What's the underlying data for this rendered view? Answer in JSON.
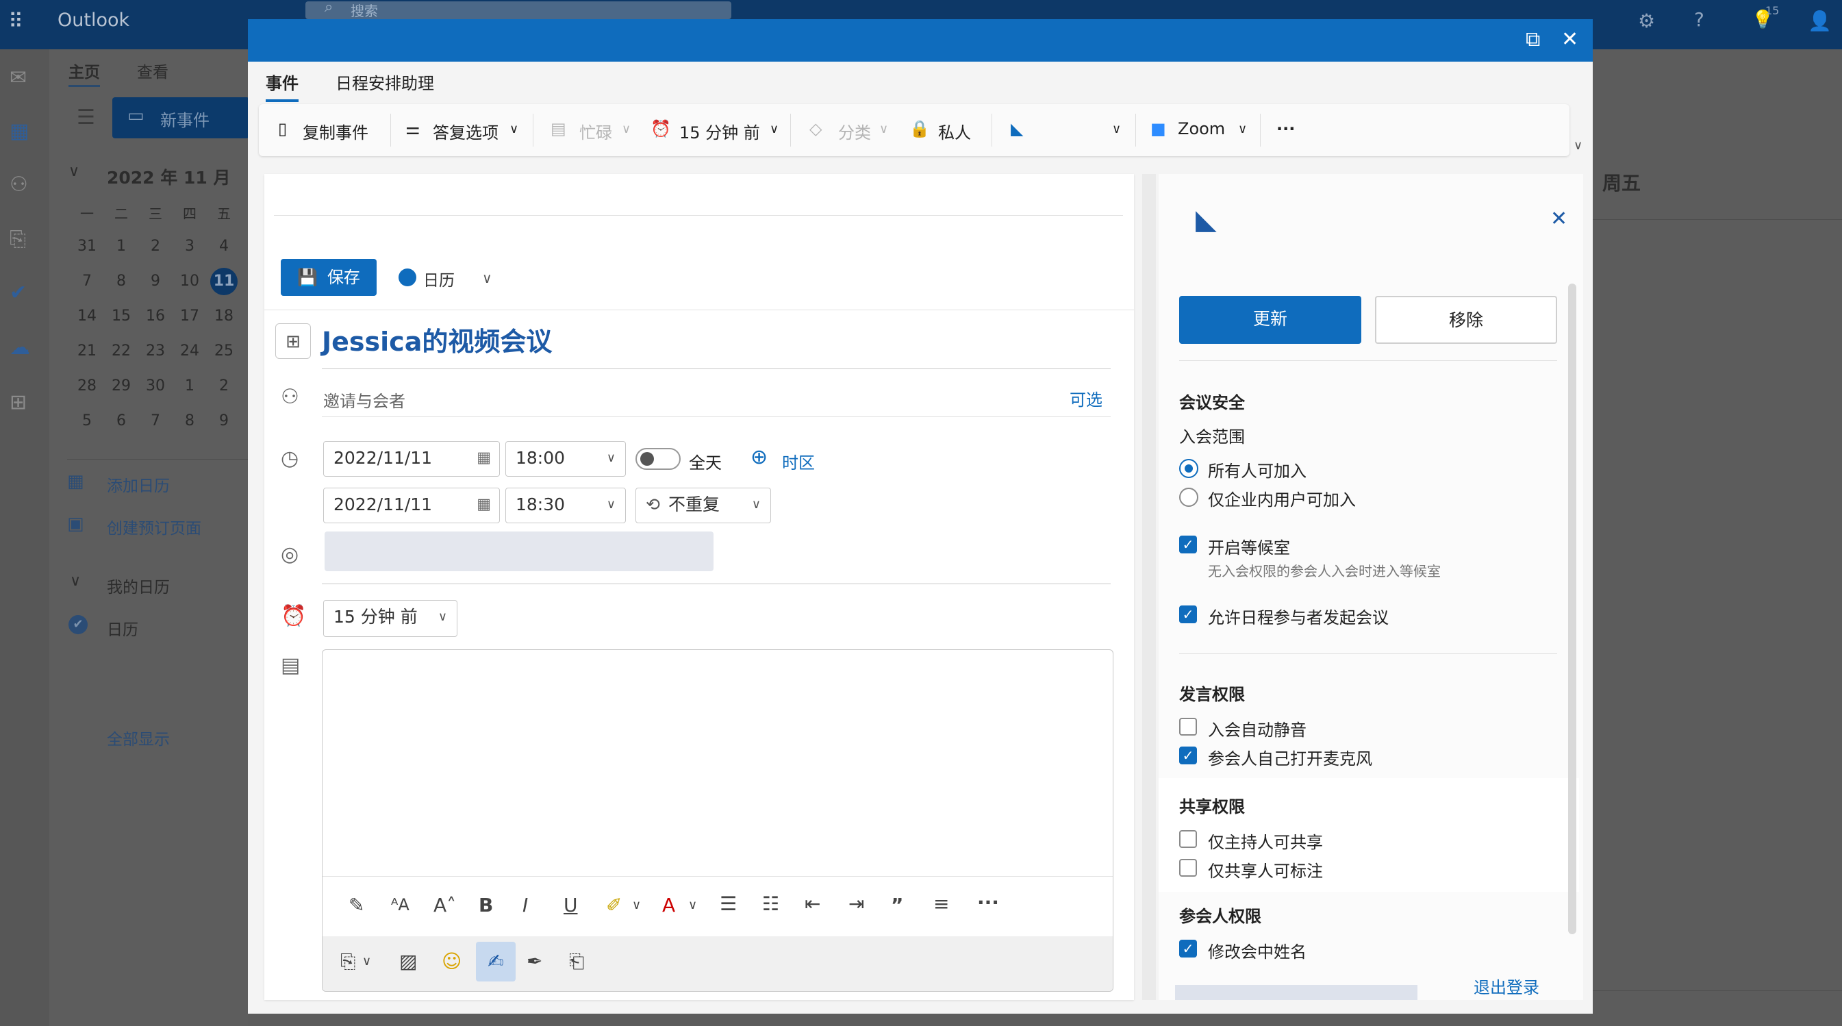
{
  "background": {
    "app_name": "Outlook",
    "search_placeholder": "搜索",
    "tabs": [
      "主页",
      "查看"
    ],
    "new_event_label": "新事件",
    "mini_calendar": {
      "title": "2022 年 11 月",
      "weekdays": [
        "一",
        "二",
        "三",
        "四",
        "五"
      ],
      "weeks": [
        [
          "31",
          "1",
          "2",
          "3",
          "4"
        ],
        [
          "7",
          "8",
          "9",
          "10",
          "11"
        ],
        [
          "14",
          "15",
          "16",
          "17",
          "18"
        ],
        [
          "21",
          "22",
          "23",
          "24",
          "25"
        ],
        [
          "28",
          "29",
          "30",
          "1",
          "2"
        ],
        [
          "5",
          "6",
          "7",
          "8",
          "9"
        ]
      ],
      "today": "11"
    },
    "add_calendar": "添加日历",
    "create_booking_page": "创建预订页面",
    "my_calendars": "我的日历",
    "calendar_item": "日历",
    "show_all": "全部显示",
    "day_header": "周五",
    "notification_badge": "15"
  },
  "modal": {
    "tabs": {
      "event": "事件",
      "scheduling": "日程安排助理"
    },
    "toolbar": {
      "copy_event": "复制事件",
      "response_options": "答复选项",
      "busy": "忙碌",
      "reminder": "15 分钟 前",
      "categorize": "分类",
      "private": "私人",
      "zoom": "Zoom",
      "more": "···"
    },
    "form": {
      "save": "保存",
      "calendar": "日历",
      "title": "Jessica的视频会议",
      "invite_placeholder": "邀请与会者",
      "optional": "可选",
      "start_date": "2022/11/11",
      "start_time": "18:00",
      "all_day": "全天",
      "timezone": "时区",
      "end_date": "2022/11/11",
      "end_time": "18:30",
      "repeat": "不重复",
      "reminder": "15 分钟 前"
    }
  },
  "addin": {
    "update_button": "更新",
    "remove_button": "移除",
    "security_heading": "会议安全",
    "join_scope_label": "入会范围",
    "join_options": [
      {
        "label": "所有人可加入",
        "selected": true
      },
      {
        "label": "仅企业内用户可加入",
        "selected": false
      }
    ],
    "waiting_room": {
      "label": "开启等候室",
      "checked": true,
      "hint": "无入会权限的参会人入会时进入等候室"
    },
    "allow_attendee_start": {
      "label": "允许日程参与者发起会议",
      "checked": true
    },
    "speak_heading": "发言权限",
    "mute_on_entry": {
      "label": "入会自动静音",
      "checked": false
    },
    "self_unmute": {
      "label": "参会人自己打开麦克风",
      "checked": true
    },
    "share_heading": "共享权限",
    "host_only_share": {
      "label": "仅主持人可共享",
      "checked": false
    },
    "sharer_only_annotate": {
      "label": "仅共享人可标注",
      "checked": false
    },
    "participant_heading": "参会人权限",
    "rename_in_meeting": {
      "label": "修改会中姓名",
      "checked": true
    },
    "logout": "退出登录"
  },
  "colors": {
    "accent": "#0f6cbd",
    "title_bar": "#0f6cbd"
  }
}
